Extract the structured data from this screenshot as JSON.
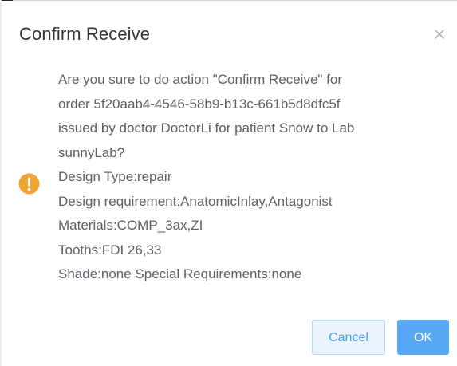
{
  "dialog": {
    "title": "Confirm Receive",
    "close_icon": "close-icon",
    "status_icon": "warning-icon",
    "message_lines": [
      "Are you sure to do action \"Confirm Receive\" for",
      "order 5f20aab4-4546-58b9-b13c-661b5d8dfc5f",
      "issued by doctor DoctorLi for patient Snow to Lab",
      "sunnyLab?",
      "Design Type:repair",
      "Design requirement:AnatomicInlay,Antagonist",
      "Materials:COMP_3ax,ZI",
      "Tooths:FDI 26,33",
      "Shade:none Special Requirements:none"
    ],
    "buttons": {
      "cancel_label": "Cancel",
      "ok_label": "OK"
    }
  },
  "colors": {
    "warning": "#f0a431",
    "primary": "#409eff",
    "primary_button": "#57a8f7",
    "text": "#5c6068",
    "title": "#30343b"
  }
}
